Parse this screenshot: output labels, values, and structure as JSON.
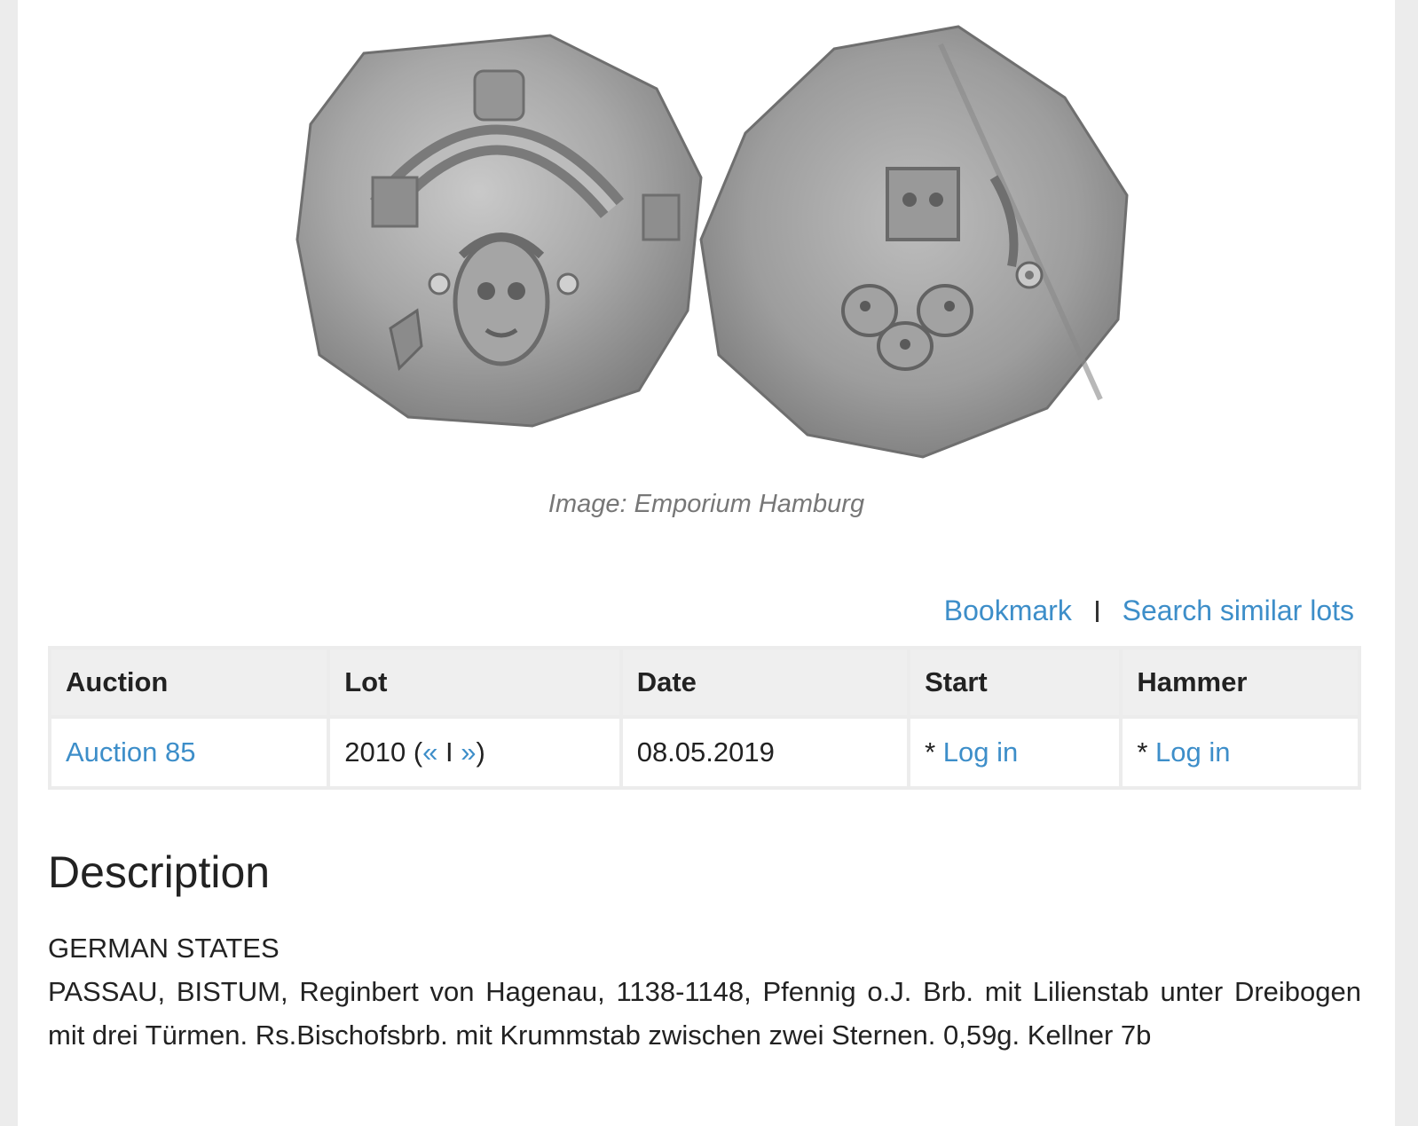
{
  "image": {
    "caption": "Image: Emporium Hamburg"
  },
  "actions": {
    "bookmark": "Bookmark",
    "search_similar": "Search similar lots"
  },
  "table": {
    "headers": [
      "Auction",
      "Lot",
      "Date",
      "Start",
      "Hammer"
    ],
    "row": {
      "auction": "Auction 85",
      "lot_number": "2010",
      "lot_open": " (",
      "prev": "«",
      "lot_sep": " I ",
      "next": "»",
      "lot_close": ")",
      "date": "08.05.2019",
      "start_prefix": "* ",
      "start_link": "Log in",
      "hammer_prefix": "* ",
      "hammer_link": "Log in"
    }
  },
  "description": {
    "title": "Description",
    "category": "GERMAN STATES",
    "text": "PASSAU, BISTUM, Reginbert von Hagenau, 1138-1148, Pfennig o.J. Brb. mit Lilienstab unter Dreibogen mit drei Türmen. Rs.Bischofsbrb. mit Krummstab zwischen zwei Sternen. 0,59g. Kellner 7b"
  },
  "colors": {
    "link": "#3d8ec9",
    "page_background": "#ececec",
    "table_header": "#efefef"
  }
}
